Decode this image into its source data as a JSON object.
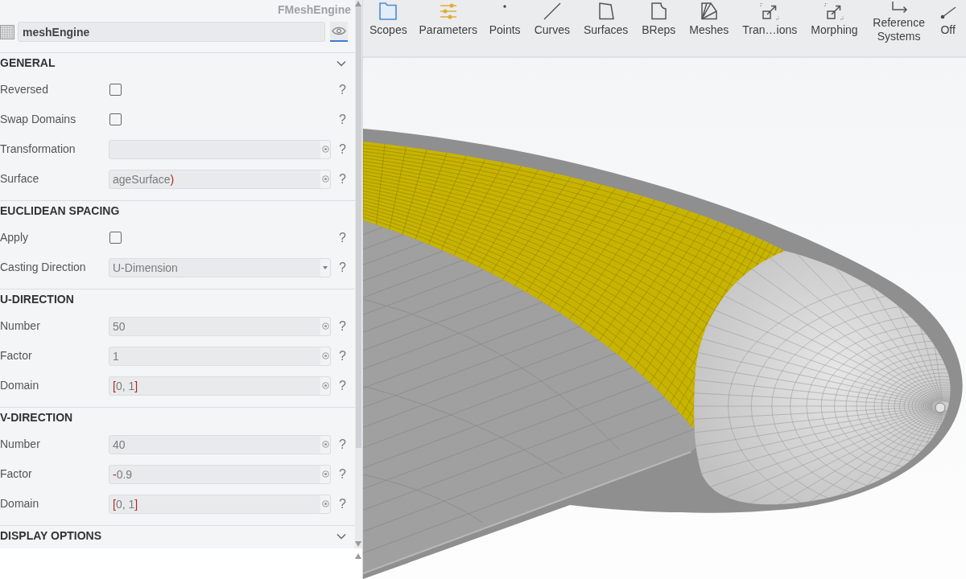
{
  "panel": {
    "title": "FMeshEngine",
    "name": "meshEngine",
    "visible": true,
    "sections": [
      {
        "title": "GENERAL",
        "chevron": true,
        "rows": [
          {
            "kind": "checkbox",
            "label": "Reversed",
            "checked": false,
            "help": "?"
          },
          {
            "kind": "checkbox",
            "label": "Swap Domains",
            "checked": false,
            "help": "?"
          },
          {
            "kind": "expression",
            "label": "Transformation",
            "help": "?"
          },
          {
            "kind": "expression",
            "label": "Surface",
            "value": "ageSurface)",
            "help": "?"
          }
        ]
      },
      {
        "title": "EUCLIDEAN SPACING",
        "chevron": false,
        "rows": [
          {
            "kind": "checkbox",
            "label": "Apply",
            "checked": false,
            "help": "?"
          },
          {
            "kind": "dropdown",
            "label": "Casting Direction",
            "value": "U-Dimension",
            "help": "?"
          }
        ]
      },
      {
        "title": "U-DIRECTION",
        "chevron": false,
        "rows": [
          {
            "kind": "expression",
            "label": "Number",
            "value": "50",
            "help": "?"
          },
          {
            "kind": "expression",
            "label": "Factor",
            "value": "1",
            "help": "?"
          },
          {
            "kind": "expression",
            "label": "Domain",
            "value": "[0, 1]",
            "help": "?"
          }
        ]
      },
      {
        "title": "V-DIRECTION",
        "chevron": false,
        "rows": [
          {
            "kind": "expression",
            "label": "Number",
            "value": "40",
            "help": "?"
          },
          {
            "kind": "expression",
            "label": "Factor",
            "value": "-0.9",
            "help": "?"
          },
          {
            "kind": "expression",
            "label": "Domain",
            "value": "[0, 1]",
            "help": "?"
          }
        ]
      },
      {
        "title": "DISPLAY OPTIONS",
        "chevron": true
      }
    ]
  },
  "toolbar": {
    "items": [
      {
        "label": "Scopes"
      },
      {
        "label": "Parameters"
      },
      {
        "label": "Points"
      },
      {
        "label": "Curves"
      },
      {
        "label": "Surfaces"
      },
      {
        "label": "BReps"
      },
      {
        "label": "Meshes"
      },
      {
        "label": "Tran…ions"
      },
      {
        "label": "Morphing"
      },
      {
        "label": "Reference Systems"
      },
      {
        "label": "Off"
      }
    ]
  }
}
